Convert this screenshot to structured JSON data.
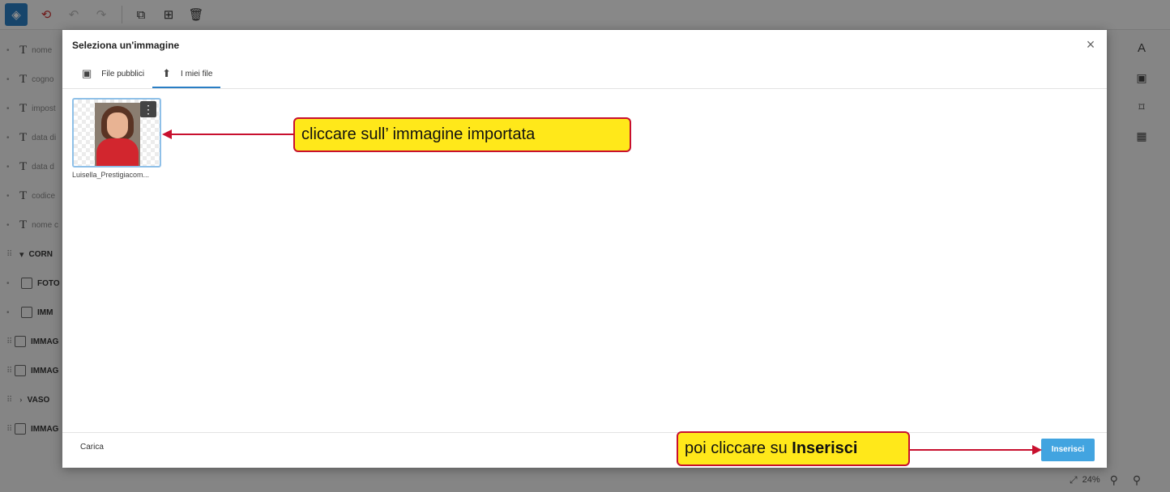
{
  "toolbar": {
    "icons": [
      "layers-icon",
      "history-icon",
      "undo-icon",
      "redo-icon",
      "clone-icon",
      "group-icon",
      "delete-icon"
    ]
  },
  "layers": [
    {
      "name": "nome",
      "kind": "text"
    },
    {
      "name": "cogno",
      "kind": "text"
    },
    {
      "name": "impost",
      "kind": "text"
    },
    {
      "name": "data di",
      "kind": "text"
    },
    {
      "name": "data d",
      "kind": "text"
    },
    {
      "name": "codice",
      "kind": "text"
    },
    {
      "name": "nome c",
      "kind": "text"
    },
    {
      "name": "CORN",
      "kind": "group"
    },
    {
      "name": "FOTO",
      "kind": "image"
    },
    {
      "name": "IMM",
      "kind": "image"
    },
    {
      "name": "IMMAG",
      "kind": "image"
    },
    {
      "name": "IMMAG",
      "kind": "image"
    },
    {
      "name": "VASO",
      "kind": "group"
    },
    {
      "name": "IMMAG",
      "kind": "image"
    }
  ],
  "rightbar": {
    "text_tool": "A",
    "icons": [
      "text-icon",
      "image-icon",
      "frame-icon",
      "qr-icon"
    ]
  },
  "zoom": {
    "value": "24%"
  },
  "modal": {
    "title": "Seleziona un'immagine",
    "close": "×",
    "tabs": [
      {
        "label": "File pubblici",
        "icon": "image-icon",
        "active": false
      },
      {
        "label": "I miei file",
        "icon": "upload-icon",
        "active": true
      }
    ],
    "file": {
      "name": "Luisella_Prestigiacom...",
      "menu": "⋮"
    },
    "footer": {
      "upload_label": "Carica",
      "insert_label": "Inserisci"
    }
  },
  "callouts": {
    "image_hint": "cliccare sull’ immagine importata",
    "insert_hint_prefix": "poi cliccare su ",
    "insert_hint_bold": "Inserisci"
  },
  "colors": {
    "accent": "#2a7ec4",
    "insert_button": "#42a4e0",
    "callout_fill": "#ffe81a",
    "callout_border": "#c8102e"
  }
}
